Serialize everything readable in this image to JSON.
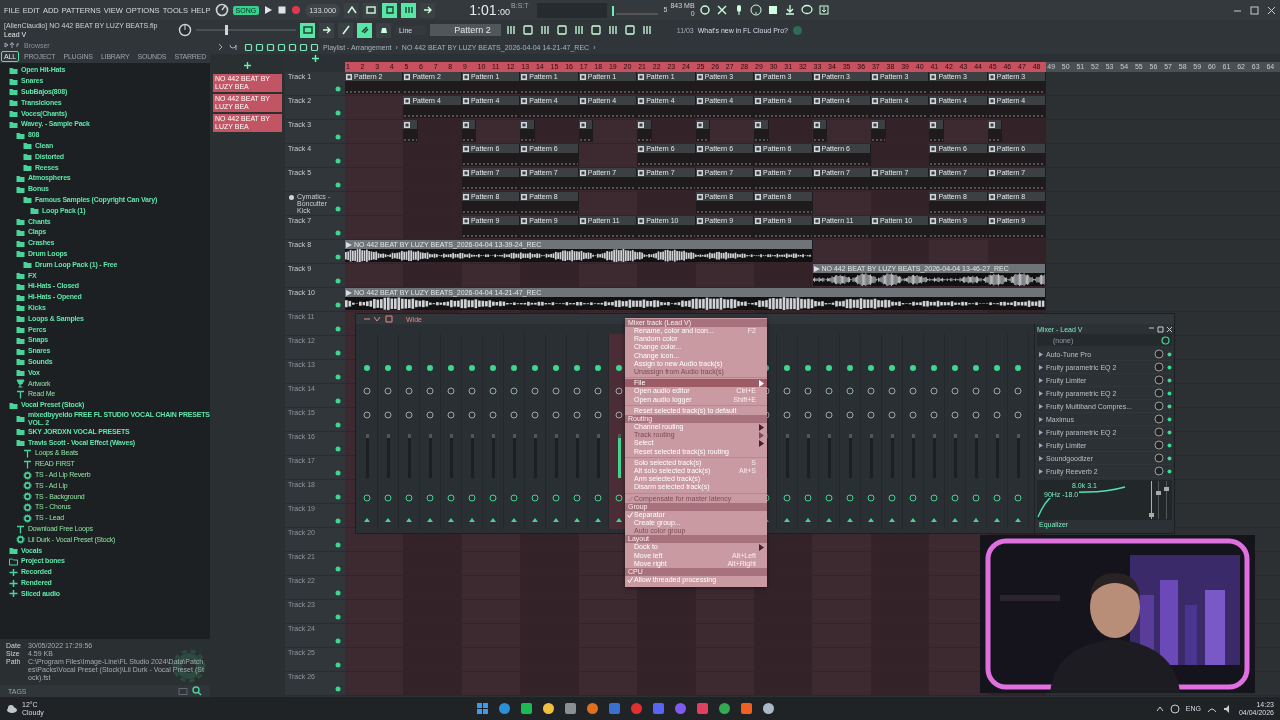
{
  "menu": [
    "FILE",
    "EDIT",
    "ADD",
    "PATTERNS",
    "VIEW",
    "OPTIONS",
    "TOOLS",
    "HELP"
  ],
  "transport": {
    "mode": "SONG",
    "mode_on": true,
    "tempo": "133.000",
    "time": "1:01",
    "time_small": ":00",
    "time_label": "B:S:T",
    "cpu": "5",
    "memory": "843 MB",
    "polyphony": "0"
  },
  "toggles_row1": [
    {
      "on": false
    },
    {
      "on": false
    },
    {
      "on": true
    },
    {
      "on": true
    },
    {
      "on": false
    }
  ],
  "toggles_row2": [
    {
      "on": true
    },
    {
      "on": false
    },
    {
      "on": false
    },
    {
      "on": true
    },
    {
      "on": false
    }
  ],
  "pitch_slider": {
    "level": 0.3
  },
  "project_title": "[AlienClaudio] NO 442 BEAT BY LUZY BEATS.flp",
  "hint": "Lead V",
  "snap": "Line",
  "pattern": "Pattern 2",
  "news_date": "11/03",
  "news": "What's new in FL Cloud Pro?",
  "browser": {
    "title": "Browser",
    "tabs": [
      {
        "label": "ALL",
        "selected": true
      },
      {
        "label": "PROJECT",
        "selected": false
      },
      {
        "label": "PLUGINS",
        "selected": false
      },
      {
        "label": "LIBRARY",
        "selected": false
      },
      {
        "label": "SOUNDS",
        "selected": false
      },
      {
        "label": "STARRED",
        "selected": false
      }
    ],
    "tree": [
      {
        "label": "Open Hit-Hats",
        "kind": "folder"
      },
      {
        "label": "Snares",
        "kind": "folder"
      },
      {
        "label": "SubBajos(808)",
        "kind": "folder"
      },
      {
        "label": "Transiciones",
        "kind": "folder"
      },
      {
        "label": "Voces(Chants)",
        "kind": "folder"
      },
      {
        "label": "Wavey. - Sample Pack",
        "kind": "folder",
        "children": [
          {
            "label": "808",
            "kind": "folder",
            "children": [
              {
                "label": "Clean",
                "kind": "folder"
              },
              {
                "label": "Distorted",
                "kind": "folder"
              },
              {
                "label": "Reeses",
                "kind": "folder"
              }
            ]
          },
          {
            "label": "Atmospheres",
            "kind": "folder"
          },
          {
            "label": "Bonus",
            "kind": "folder",
            "children": [
              {
                "label": "Famous Samples (Copyright Can Vary)",
                "kind": "folder",
                "children": [
                  {
                    "label": "Loop Pack (1)",
                    "kind": "folder"
                  }
                ]
              }
            ]
          },
          {
            "label": "Chants",
            "kind": "folder"
          },
          {
            "label": "Claps",
            "kind": "folder"
          },
          {
            "label": "Crashes",
            "kind": "folder"
          },
          {
            "label": "Drum Loops",
            "kind": "folder",
            "children": [
              {
                "label": "Drum Loop Pack (1) - Free",
                "kind": "folder"
              }
            ]
          },
          {
            "label": "FX",
            "kind": "folder"
          },
          {
            "label": "Hi-Hats - Closed",
            "kind": "folder"
          },
          {
            "label": "Hi-Hats - Opened",
            "kind": "folder"
          },
          {
            "label": "Kicks",
            "kind": "folder"
          },
          {
            "label": "Loops & Samples",
            "kind": "folder"
          },
          {
            "label": "Percs",
            "kind": "folder"
          },
          {
            "label": "Snaps",
            "kind": "folder"
          },
          {
            "label": "Snares",
            "kind": "folder"
          },
          {
            "label": "Sounds",
            "kind": "folder"
          },
          {
            "label": "Vox",
            "kind": "folder"
          },
          {
            "label": "Artwork"
          },
          {
            "label": "Read Me",
            "kind": "text"
          }
        ]
      },
      {
        "label": "Vocal Preset (Stock)",
        "kind": "folder",
        "children": [
          {
            "label": "mixedbyyeldo FREE FL STUDIO VOCAL CHAIN PRESETS VOL. 2",
            "kind": "folder"
          },
          {
            "label": "SKY JORDXN VOCAL PRESETS",
            "kind": "folder"
          },
          {
            "label": "Travis Scott - Vocal Effect (Waves)",
            "kind": "folder",
            "children": [
              {
                "label": "Loops & Beats",
                "kind": "text"
              },
              {
                "label": "READ FIRST",
                "kind": "text"
              },
              {
                "label": "TS - Ad Lip Reverb",
                "kind": "preset"
              },
              {
                "label": "TS - Ad Lip",
                "kind": "preset"
              },
              {
                "label": "TS - Background",
                "kind": "preset"
              },
              {
                "label": "TS - Chorus",
                "kind": "preset"
              },
              {
                "label": "TS - Lead",
                "kind": "preset"
              }
            ]
          },
          {
            "label": "Download Free Loops",
            "kind": "text"
          },
          {
            "label": "Lil Durk - Vocal Preset (Stock)",
            "kind": "preset"
          }
        ]
      },
      {
        "label": "Vocals",
        "kind": "folder"
      },
      {
        "label": "Project bones",
        "kind": "project"
      },
      {
        "label": "Recorded",
        "kind": "audio"
      },
      {
        "label": "Rendered",
        "kind": "audio"
      },
      {
        "label": "Sliced audio",
        "kind": "audio"
      }
    ],
    "info": [
      {
        "label": "Date",
        "value": "30/05/2022 17:29:56"
      },
      {
        "label": "Size",
        "value": "4.59 KB"
      },
      {
        "label": "Path",
        "value": "C:\\Program Files\\Image-Line\\FL Studio 2024\\Data\\Patches\\Packs\\Vocal Preset (Stock)\\Lil Durk - Vocal Preset (Stock).fst"
      }
    ],
    "tags": "TAGS"
  },
  "playlist": {
    "title": "Playlist - Arrangement",
    "separator_1": "›",
    "file": "NO 442 BEAT BY LUZY BEATS_2026-04-04 14-21-47_REC",
    "separator_2": "›",
    "clip_list": [
      "NO 442 BEAT BY LUZY BEA",
      "NO 442 BEAT BY LUZY BEA",
      "NO 442 BEAT BY LUZY BEA"
    ],
    "ruler": [
      "1",
      "2",
      "3",
      "4",
      "5",
      "6",
      "7",
      "8",
      "9",
      "10",
      "11",
      "12",
      "13",
      "14",
      "15",
      "16",
      "17",
      "18",
      "19",
      "20",
      "21",
      "22",
      "23",
      "24",
      "25",
      "26",
      "27",
      "28",
      "29",
      "30",
      "31",
      "32",
      "33",
      "34",
      "35",
      "36",
      "37",
      "38",
      "39",
      "40",
      "41",
      "42",
      "43",
      "44",
      "45",
      "46",
      "47",
      "48",
      "49",
      "50",
      "51",
      "52",
      "53",
      "54",
      "55",
      "56",
      "57",
      "58",
      "59",
      "60",
      "61",
      "62",
      "63",
      "64"
    ],
    "tracks": [
      {
        "name": "Track 1",
        "kind": "plain",
        "slots": [
          {
            "kind": "pattern",
            "label": "Pattern 2"
          },
          {
            "kind": "pattern",
            "label": "Pattern 2"
          },
          {
            "kind": "pattern",
            "label": "Pattern 1"
          },
          {
            "kind": "pattern",
            "label": "Pattern 1"
          },
          {
            "kind": "pattern",
            "label": "Pattern 1"
          },
          {
            "kind": "pattern",
            "label": "Pattern 1"
          },
          {
            "kind": "pattern",
            "label": "Pattern 3"
          },
          {
            "kind": "pattern",
            "label": "Pattern 3"
          },
          {
            "kind": "pattern",
            "label": "Pattern 3"
          },
          {
            "kind": "pattern",
            "label": "Pattern 3"
          },
          {
            "kind": "pattern",
            "label": "Pattern 3"
          },
          {
            "kind": "pattern",
            "label": "Pattern 3"
          }
        ]
      },
      {
        "name": "Track 2",
        "kind": "plain",
        "slots": [
          {
            "kind": "empty"
          },
          {
            "kind": "pattern",
            "label": "Pattern 4"
          },
          {
            "kind": "pattern",
            "label": "Pattern 4"
          },
          {
            "kind": "pattern",
            "label": "Pattern 4"
          },
          {
            "kind": "pattern",
            "label": "Pattern 4"
          },
          {
            "kind": "pattern",
            "label": "Pattern 4"
          },
          {
            "kind": "pattern",
            "label": "Pattern 4"
          },
          {
            "kind": "pattern",
            "label": "Pattern 4"
          },
          {
            "kind": "pattern",
            "label": "Pattern 4"
          },
          {
            "kind": "pattern",
            "label": "Pattern 4"
          },
          {
            "kind": "pattern",
            "label": "Pattern 4"
          },
          {
            "kind": "pattern",
            "label": "Pattern 4"
          }
        ]
      },
      {
        "name": "Track 3",
        "kind": "plain",
        "slots": [
          {
            "kind": "empty"
          },
          {
            "kind": "short"
          },
          {
            "kind": "short"
          },
          {
            "kind": "short"
          },
          {
            "kind": "short"
          },
          {
            "kind": "short"
          },
          {
            "kind": "short"
          },
          {
            "kind": "short"
          },
          {
            "kind": "short"
          },
          {
            "kind": "short"
          },
          {
            "kind": "short"
          },
          {
            "kind": "short"
          }
        ]
      },
      {
        "name": "Track 4",
        "kind": "plain",
        "slots": [
          {
            "kind": "empty"
          },
          {
            "kind": "empty"
          },
          {
            "kind": "pattern",
            "label": "Pattern 6"
          },
          {
            "kind": "pattern",
            "label": "Pattern 6"
          },
          {
            "kind": "empty"
          },
          {
            "kind": "pattern",
            "label": "Pattern 6"
          },
          {
            "kind": "pattern",
            "label": "Pattern 6"
          },
          {
            "kind": "pattern",
            "label": "Pattern 6"
          },
          {
            "kind": "pattern",
            "label": "Pattern 6"
          },
          {
            "kind": "empty"
          },
          {
            "kind": "pattern",
            "label": "Pattern 6"
          },
          {
            "kind": "pattern",
            "label": "Pattern 6"
          }
        ]
      },
      {
        "name": "Track 5",
        "kind": "plain",
        "slots": [
          {
            "kind": "empty"
          },
          {
            "kind": "empty"
          },
          {
            "kind": "pattern",
            "label": "Pattern 7"
          },
          {
            "kind": "pattern",
            "label": "Pattern 7"
          },
          {
            "kind": "pattern",
            "label": "Pattern 7"
          },
          {
            "kind": "pattern",
            "label": "Pattern 7"
          },
          {
            "kind": "pattern",
            "label": "Pattern 7"
          },
          {
            "kind": "pattern",
            "label": "Pattern 7"
          },
          {
            "kind": "pattern",
            "label": "Pattern 7"
          },
          {
            "kind": "pattern",
            "label": "Pattern 7"
          },
          {
            "kind": "pattern",
            "label": "Pattern 7"
          },
          {
            "kind": "pattern",
            "label": "Pattern 7"
          }
        ]
      },
      {
        "name": "Cymatics - Boncutter Kick",
        "kind": "instrument",
        "slots": [
          {
            "kind": "empty"
          },
          {
            "kind": "empty"
          },
          {
            "kind": "pattern",
            "label": "Pattern 8"
          },
          {
            "kind": "pattern",
            "label": "Pattern 8"
          },
          {
            "kind": "empty"
          },
          {
            "kind": "empty"
          },
          {
            "kind": "pattern",
            "label": "Pattern 8"
          },
          {
            "kind": "pattern",
            "label": "Pattern 8"
          },
          {
            "kind": "empty"
          },
          {
            "kind": "empty"
          },
          {
            "kind": "pattern",
            "label": "Pattern 8"
          },
          {
            "kind": "pattern",
            "label": "Pattern 8"
          }
        ]
      },
      {
        "name": "Track 7",
        "kind": "plain",
        "slots": [
          {
            "kind": "empty"
          },
          {
            "kind": "empty"
          },
          {
            "kind": "pattern",
            "label": "Pattern 9"
          },
          {
            "kind": "pattern",
            "label": "Pattern 9"
          },
          {
            "kind": "pattern",
            "label": "Pattern 11"
          },
          {
            "kind": "pattern",
            "label": "Pattern 10"
          },
          {
            "kind": "pattern",
            "label": "Pattern 9"
          },
          {
            "kind": "pattern",
            "label": "Pattern 9"
          },
          {
            "kind": "pattern",
            "label": "Pattern 11"
          },
          {
            "kind": "pattern",
            "label": "Pattern 10"
          },
          {
            "kind": "pattern",
            "label": "Pattern 9"
          },
          {
            "kind": "pattern",
            "label": "Pattern 9"
          }
        ]
      },
      {
        "name": "Track 8",
        "kind": "plain",
        "slots": [
          {
            "kind": "audio",
            "label": "NO 442 BEAT BY LUZY BEATS_2026-04-04 13-39-24_REC"
          },
          {
            "kind": "cont"
          },
          {
            "kind": "cont"
          },
          {
            "kind": "cont"
          },
          {
            "kind": "cont"
          },
          {
            "kind": "cont"
          },
          {
            "kind": "cont"
          },
          {
            "kind": "cont"
          },
          {
            "kind": "empty"
          },
          {
            "kind": "empty"
          },
          {
            "kind": "empty"
          },
          {
            "kind": "empty"
          }
        ]
      },
      {
        "name": "Track 9",
        "kind": "plain",
        "slots": [
          {
            "kind": "empty"
          },
          {
            "kind": "empty"
          },
          {
            "kind": "empty"
          },
          {
            "kind": "empty"
          },
          {
            "kind": "empty"
          },
          {
            "kind": "empty"
          },
          {
            "kind": "empty"
          },
          {
            "kind": "empty"
          },
          {
            "kind": "audio",
            "label": "NO 442 BEAT BY LUZY BEATS_2026-04-04 13-46-27_REC"
          },
          {
            "kind": "cont"
          },
          {
            "kind": "cont"
          },
          {
            "kind": "cont"
          }
        ]
      },
      {
        "name": "Track 10",
        "kind": "plain",
        "slots": [
          {
            "kind": "audio",
            "label": "NO 442 BEAT BY LUZY BEATS_2026-04-04 14-21-47_REC"
          },
          {
            "kind": "cont"
          },
          {
            "kind": "cont"
          },
          {
            "kind": "cont"
          },
          {
            "kind": "cont"
          },
          {
            "kind": "cont"
          },
          {
            "kind": "cont"
          },
          {
            "kind": "cont"
          },
          {
            "kind": "cont"
          },
          {
            "kind": "cont"
          },
          {
            "kind": "cont"
          },
          {
            "kind": "cont"
          }
        ]
      },
      {
        "name": "Track 11",
        "kind": "plain"
      },
      {
        "name": "Track 12",
        "kind": "plain"
      },
      {
        "name": "Track 13",
        "kind": "plain"
      },
      {
        "name": "Track 14",
        "kind": "plain"
      },
      {
        "name": "Track 15",
        "kind": "plain"
      },
      {
        "name": "Track 16",
        "kind": "plain"
      },
      {
        "name": "Track 17",
        "kind": "plain"
      },
      {
        "name": "Track 18",
        "kind": "plain"
      },
      {
        "name": "Track 19",
        "kind": "plain"
      },
      {
        "name": "Track 20",
        "kind": "plain"
      },
      {
        "name": "Track 21",
        "kind": "plain"
      },
      {
        "name": "Track 22",
        "kind": "plain"
      },
      {
        "name": "Track 23",
        "kind": "plain"
      },
      {
        "name": "Track 24",
        "kind": "plain"
      },
      {
        "name": "Track 25",
        "kind": "plain"
      },
      {
        "name": "Track 26",
        "kind": "plain"
      }
    ]
  },
  "mixer": {
    "view": "Wide",
    "strips": [
      {
        "kind": "strip",
        "selected": false
      },
      {
        "kind": "strip",
        "selected": false
      },
      {
        "kind": "strip",
        "selected": false
      },
      {
        "kind": "strip",
        "selected": false
      },
      {
        "kind": "strip",
        "selected": false
      },
      {
        "kind": "strip",
        "selected": false
      },
      {
        "kind": "strip",
        "selected": false
      },
      {
        "kind": "strip",
        "selected": false
      },
      {
        "kind": "strip",
        "selected": false
      },
      {
        "kind": "strip",
        "selected": false
      },
      {
        "kind": "strip",
        "selected": false
      },
      {
        "kind": "strip",
        "selected": false
      },
      {
        "kind": "strip",
        "selected": true
      },
      {
        "kind": "covered"
      },
      {
        "kind": "covered"
      },
      {
        "kind": "covered"
      },
      {
        "kind": "covered"
      },
      {
        "kind": "covered"
      },
      {
        "kind": "covered"
      },
      {
        "kind": "strip",
        "selected": false
      },
      {
        "kind": "strip",
        "selected": false
      },
      {
        "kind": "strip",
        "selected": false
      },
      {
        "kind": "strip",
        "selected": false
      },
      {
        "kind": "strip",
        "selected": false
      },
      {
        "kind": "strip",
        "selected": false
      },
      {
        "kind": "strip",
        "selected": false
      },
      {
        "kind": "strip",
        "selected": false
      },
      {
        "kind": "strip",
        "selected": false
      },
      {
        "kind": "strip",
        "selected": false
      },
      {
        "kind": "strip",
        "selected": false
      },
      {
        "kind": "strip",
        "selected": false
      },
      {
        "kind": "strip",
        "selected": false
      }
    ],
    "panel_title": "Mixer - Lead V",
    "input": "(none)",
    "slots": [
      {
        "name": "Auto-Tune Pro",
        "on": true
      },
      {
        "name": "Fruity parametric EQ 2",
        "on": true
      },
      {
        "name": "Fruity Limiter",
        "on": true
      },
      {
        "name": "Fruity parametric EQ 2",
        "on": true
      },
      {
        "name": "Fruity Multiband Compres...",
        "on": true
      },
      {
        "name": "Maximus",
        "on": true
      },
      {
        "name": "Fruity parametric EQ 2",
        "on": true
      },
      {
        "name": "Fruity Limiter",
        "on": true
      },
      {
        "name": "Soundgoodizer",
        "on": true
      },
      {
        "name": "Fruity Reeverb 2",
        "on": true
      }
    ],
    "eq_high": "8.0k 3.1",
    "eq_low": "90Hz -18.0",
    "eq_title": "Equalizer"
  },
  "context_menu": [
    {
      "kind": "header",
      "label": "Mixer track (Lead V)"
    },
    {
      "kind": "item",
      "label": "Rename, color and icon...",
      "shortcut": "F2",
      "submenu": false,
      "disabled": false,
      "checked": false,
      "selected": false
    },
    {
      "kind": "item",
      "label": "Random color",
      "submenu": false,
      "disabled": false,
      "checked": false,
      "selected": false
    },
    {
      "kind": "item",
      "label": "Change color...",
      "submenu": false,
      "disabled": false,
      "checked": false,
      "selected": false
    },
    {
      "kind": "item",
      "label": "Change icon...",
      "submenu": false,
      "disabled": false,
      "checked": false,
      "selected": false
    },
    {
      "kind": "item",
      "label": "Assign to new Audio track(s)",
      "submenu": false,
      "disabled": false,
      "checked": false,
      "selected": false
    },
    {
      "kind": "item",
      "label": "Unassign from Audio track(s)",
      "submenu": false,
      "disabled": true,
      "checked": false,
      "selected": false
    },
    {
      "kind": "divider"
    },
    {
      "kind": "item",
      "label": "File",
      "submenu": true,
      "disabled": false,
      "checked": false,
      "selected": true
    },
    {
      "kind": "item",
      "label": "Open audio editor",
      "shortcut": "Ctrl+E",
      "submenu": false,
      "disabled": false,
      "checked": false,
      "selected": false
    },
    {
      "kind": "item",
      "label": "Open audio logger",
      "shortcut": "Shift+E",
      "submenu": false,
      "disabled": false,
      "checked": false,
      "selected": false
    },
    {
      "kind": "divider"
    },
    {
      "kind": "item",
      "label": "Reset selected track(s) to default",
      "submenu": false,
      "disabled": false,
      "checked": false,
      "selected": false
    },
    {
      "kind": "header",
      "label": "Routing"
    },
    {
      "kind": "item",
      "label": "Channel routing",
      "submenu": true,
      "disabled": false,
      "checked": false,
      "selected": false
    },
    {
      "kind": "item",
      "label": "Track routing",
      "submenu": true,
      "disabled": true,
      "checked": false,
      "selected": false
    },
    {
      "kind": "item",
      "label": "Select",
      "submenu": true,
      "disabled": false,
      "checked": false,
      "selected": false
    },
    {
      "kind": "item",
      "label": "Reset selected track(s) routing",
      "submenu": false,
      "disabled": false,
      "checked": false,
      "selected": false
    },
    {
      "kind": "divider"
    },
    {
      "kind": "item",
      "label": "Solo selected track(s)",
      "shortcut": "S",
      "submenu": false,
      "disabled": false,
      "checked": false,
      "selected": false
    },
    {
      "kind": "item",
      "label": "Alt solo selected track(s)",
      "shortcut": "Alt+S",
      "submenu": false,
      "disabled": false,
      "checked": false,
      "selected": false
    },
    {
      "kind": "item",
      "label": "Arm selected track(s)",
      "submenu": false,
      "disabled": false,
      "checked": false,
      "selected": false
    },
    {
      "kind": "item",
      "label": "Disarm selected track(s)",
      "submenu": false,
      "disabled": false,
      "checked": false,
      "selected": false
    },
    {
      "kind": "divider"
    },
    {
      "kind": "item",
      "label": "Compensate for master latency",
      "submenu": false,
      "disabled": true,
      "checked": true,
      "selected": false
    },
    {
      "kind": "header",
      "label": "Group"
    },
    {
      "kind": "item",
      "label": "Separator",
      "submenu": false,
      "disabled": false,
      "checked": true,
      "selected": false
    },
    {
      "kind": "item",
      "label": "Create group...",
      "submenu": false,
      "disabled": false,
      "checked": false,
      "selected": false
    },
    {
      "kind": "item",
      "label": "Auto color group",
      "submenu": false,
      "disabled": true,
      "checked": false,
      "selected": false
    },
    {
      "kind": "header",
      "label": "Layout"
    },
    {
      "kind": "item",
      "label": "Dock to",
      "submenu": true,
      "disabled": false,
      "checked": false,
      "selected": false
    },
    {
      "kind": "item",
      "label": "Move left",
      "shortcut": "Alt+Left",
      "submenu": false,
      "disabled": false,
      "checked": false,
      "selected": false
    },
    {
      "kind": "item",
      "label": "Move right",
      "shortcut": "Alt+Right",
      "submenu": false,
      "disabled": false,
      "checked": false,
      "selected": false
    },
    {
      "kind": "header",
      "label": "CPU"
    },
    {
      "kind": "item",
      "label": "Allow threaded processing",
      "submenu": false,
      "disabled": false,
      "checked": true,
      "selected": false
    }
  ],
  "taskbar": {
    "temperature": "12°C",
    "weather": "Cloudy",
    "language": "ENG",
    "time": "14:23",
    "date": "04/04/2026"
  }
}
